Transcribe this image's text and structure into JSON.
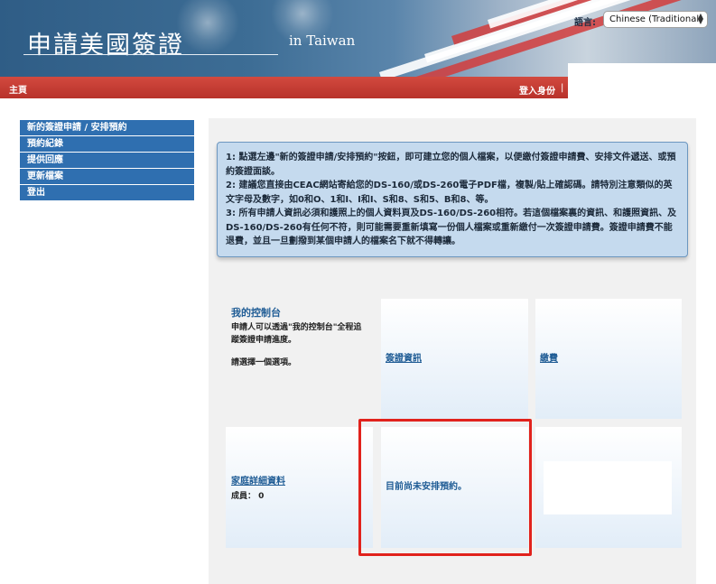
{
  "header": {
    "title": "申請美國簽證",
    "subtitle": "in Taiwan",
    "language_label": "語言:",
    "language_value": "Chinese (Traditional)"
  },
  "navbar": {
    "home": "主頁",
    "login": "登入身份",
    "separator": "|"
  },
  "sidebar": {
    "items": [
      {
        "label": "新的簽證申請 / 安排預約"
      },
      {
        "label": "預約紀錄"
      },
      {
        "label": "提供回應"
      },
      {
        "label": "更新檔案"
      },
      {
        "label": "登出"
      }
    ]
  },
  "notice": {
    "line1": "1: 點選左邊\"新的簽證申請/安排預約\"按鈕，即可建立您的個人檔案，以便繳付簽證申請費、安排文件遞送、或預約簽證面談。",
    "line2": "2: 建議您直接由CEAC網站寄給您的DS-160/或DS-260電子PDF檔，複製/貼上確認碼。請特別注意類似的英文字母及數字，如0和O、1和I、I和I、S和8、S和5、B和8、等。",
    "line3": "3: 所有申請人資訊必須和護照上的個人資料頁及DS-160/DS-260相符。若這個檔案裏的資訊、和護照資訊、及DS-160/DS-260有任何不符，則可能需要重新填寫一份個人檔案或重新繳付一次簽證申請費。簽證申請費不能退費，並且一旦劃撥到某個申請人的檔案名下就不得轉讓。"
  },
  "dashboard": {
    "title": "我的控制台",
    "description": "申請人可以透過\"我的控制台\"全程追蹤簽證申請進度。",
    "prompt": "請選擇一個選項。"
  },
  "tiles": {
    "visa_info": "簽證資訊",
    "payment": "繳費",
    "family_details": "家庭詳細資料",
    "members_label": "成員：",
    "members_count": "0",
    "appointment_status": "目前尚未安排預約。"
  },
  "colors": {
    "accent": "#2f6fb0",
    "nav_red": "#c0392b",
    "highlight": "#e1221c",
    "link": "#1f5c95"
  }
}
